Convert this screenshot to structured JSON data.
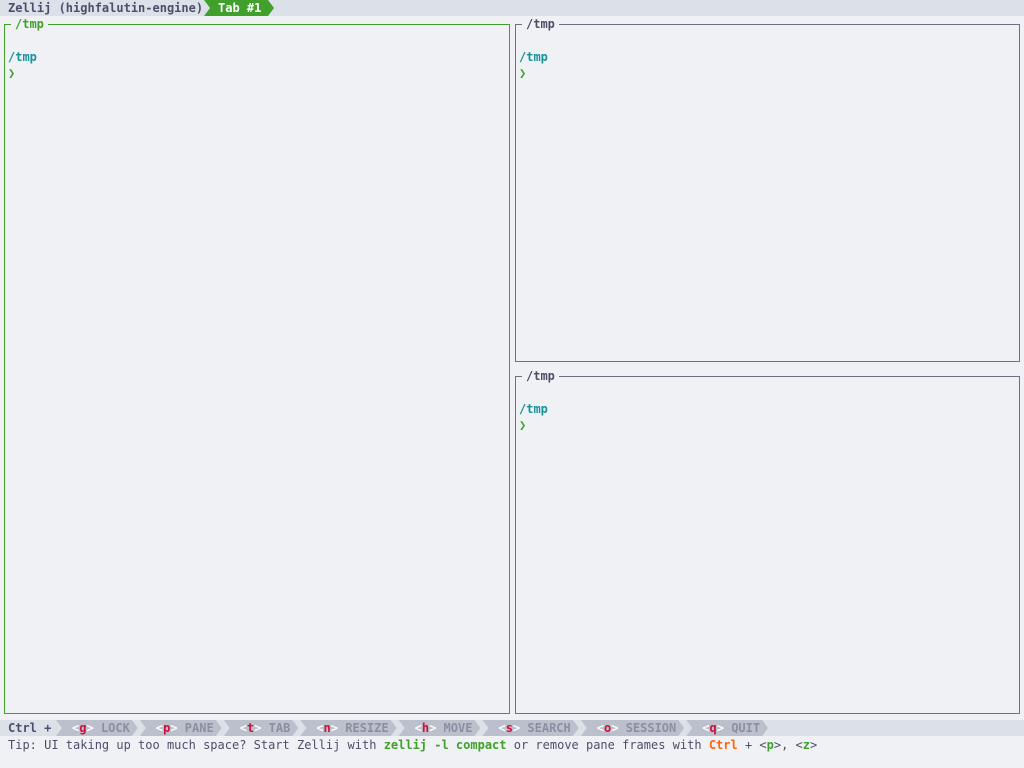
{
  "tabbar": {
    "session_name": "Zellij (highfalutin-engine)",
    "active_tab": "Tab #1"
  },
  "colors": {
    "background": "#eff1f5",
    "bar_background": "#dce0e8",
    "accent_green": "#40a02b",
    "cwd_teal": "#179299",
    "pane_border": "#6c6f85",
    "key_segment": "#bcc0cc",
    "hotkey_red": "#d20f39",
    "ctrl_orange": "#fe640b"
  },
  "panes": [
    {
      "title": "/tmp",
      "cwd": "/tmp",
      "prompt": "❯",
      "focused": true
    },
    {
      "title": "/tmp",
      "cwd": "/tmp",
      "prompt": "❯",
      "focused": false
    },
    {
      "title": "/tmp",
      "cwd": "/tmp",
      "prompt": "❯",
      "focused": false
    }
  ],
  "statusbar": {
    "ctrl_label": "Ctrl +",
    "keys": [
      {
        "key": "g",
        "label": "LOCK"
      },
      {
        "key": "p",
        "label": "PANE"
      },
      {
        "key": "t",
        "label": "TAB"
      },
      {
        "key": "n",
        "label": "RESIZE"
      },
      {
        "key": "h",
        "label": "MOVE"
      },
      {
        "key": "s",
        "label": "SEARCH"
      },
      {
        "key": "o",
        "label": "SESSION"
      },
      {
        "key": "q",
        "label": "QUIT"
      }
    ]
  },
  "tip": {
    "prefix": "Tip: UI taking up too much space? Start Zellij with ",
    "command": "zellij -l compact",
    "middle": " or remove pane frames with ",
    "ctrl": "Ctrl",
    "plus": " + <",
    "key1": "p",
    "sep": ">, <",
    "key2": "z",
    "suffix": ">"
  }
}
